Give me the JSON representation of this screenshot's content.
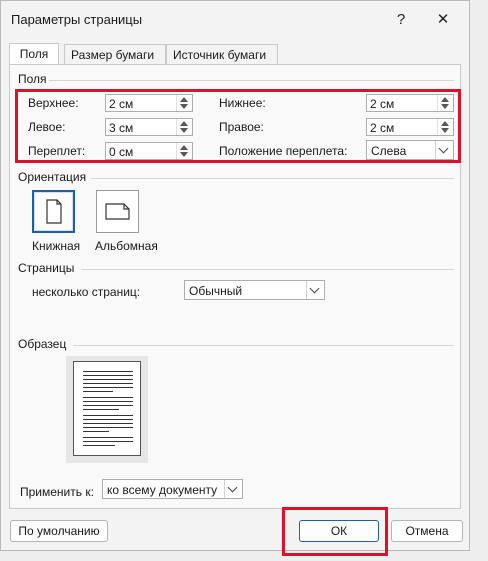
{
  "window": {
    "title": "Параметры страницы",
    "help_glyph": "?",
    "close_glyph": "✕"
  },
  "tabs": [
    {
      "label": "Поля",
      "active": true
    },
    {
      "label": "Размер бумаги",
      "active": false
    },
    {
      "label": "Источник бумаги",
      "active": false
    }
  ],
  "margins": {
    "section_label": "Поля",
    "top": {
      "label": "Верхнее:",
      "value": "2 см"
    },
    "bottom": {
      "label": "Нижнее:",
      "value": "2 см"
    },
    "left": {
      "label": "Левое:",
      "value": "3 см"
    },
    "right": {
      "label": "Правое:",
      "value": "2 см"
    },
    "gutter": {
      "label": "Переплет:",
      "value": "0 см"
    },
    "gutter_position": {
      "label": "Положение переплета:",
      "value": "Слева"
    }
  },
  "orientation": {
    "section_label": "Ориентация",
    "portrait_label": "Книжная",
    "landscape_label": "Альбомная",
    "selected": "portrait"
  },
  "pages": {
    "section_label": "Страницы",
    "multiple_label": "несколько страниц:",
    "multiple_value": "Обычный"
  },
  "preview": {
    "section_label": "Образец"
  },
  "apply": {
    "label": "Применить к:",
    "value": "ко всему документу"
  },
  "buttons": {
    "default": "По умолчанию",
    "ok": "ОК",
    "cancel": "Отмена"
  },
  "colors": {
    "highlight": "#e0102a",
    "accent": "#1f5fa8"
  }
}
